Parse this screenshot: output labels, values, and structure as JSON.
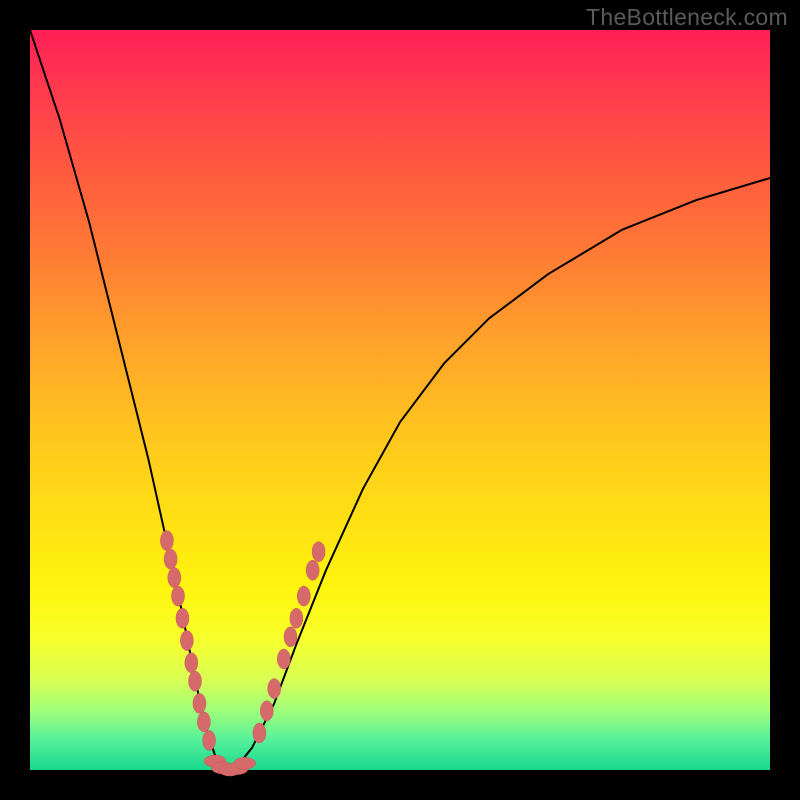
{
  "watermark": "TheBottleneck.com",
  "colors": {
    "curve": "#000000",
    "marker_fill": "#d66a6a",
    "marker_stroke": "#c95a5a",
    "background_black": "#000000"
  },
  "chart_data": {
    "type": "line",
    "title": "",
    "xlabel": "",
    "ylabel": "",
    "xlim": [
      0,
      100
    ],
    "ylim": [
      0,
      100
    ],
    "grid": false,
    "legend": false,
    "series": [
      {
        "name": "bottleneck-curve",
        "x": [
          0,
          2,
          4,
          6,
          8,
          10,
          12,
          14,
          16,
          18,
          20,
          21,
          22,
          23,
          24,
          25,
          26,
          27,
          28,
          30,
          33,
          36,
          40,
          45,
          50,
          56,
          62,
          70,
          80,
          90,
          100
        ],
        "y": [
          100,
          94,
          88,
          81,
          74,
          66,
          58,
          50,
          42,
          33,
          24,
          19,
          14,
          9,
          5,
          2,
          0.5,
          0,
          0.5,
          3,
          9,
          17,
          27,
          38,
          47,
          55,
          61,
          67,
          73,
          77,
          80
        ]
      }
    ],
    "markers": {
      "left_cluster": [
        {
          "x": 18.5,
          "y": 31
        },
        {
          "x": 19.0,
          "y": 28.5
        },
        {
          "x": 19.5,
          "y": 26
        },
        {
          "x": 20.0,
          "y": 23.5
        },
        {
          "x": 20.6,
          "y": 20.5
        },
        {
          "x": 21.2,
          "y": 17.5
        },
        {
          "x": 21.8,
          "y": 14.5
        },
        {
          "x": 22.3,
          "y": 12
        },
        {
          "x": 22.9,
          "y": 9
        },
        {
          "x": 23.5,
          "y": 6.5
        },
        {
          "x": 24.2,
          "y": 4
        }
      ],
      "bottom_cluster": [
        {
          "x": 25.0,
          "y": 1.2
        },
        {
          "x": 26.0,
          "y": 0.3
        },
        {
          "x": 27.0,
          "y": 0.0
        },
        {
          "x": 28.0,
          "y": 0.2
        },
        {
          "x": 29.0,
          "y": 0.9
        }
      ],
      "right_cluster": [
        {
          "x": 31.0,
          "y": 5
        },
        {
          "x": 32.0,
          "y": 8
        },
        {
          "x": 33.0,
          "y": 11
        },
        {
          "x": 34.3,
          "y": 15
        },
        {
          "x": 35.2,
          "y": 18
        },
        {
          "x": 36.0,
          "y": 20.5
        },
        {
          "x": 37.0,
          "y": 23.5
        },
        {
          "x": 38.2,
          "y": 27
        },
        {
          "x": 39.0,
          "y": 29.5
        }
      ]
    }
  }
}
